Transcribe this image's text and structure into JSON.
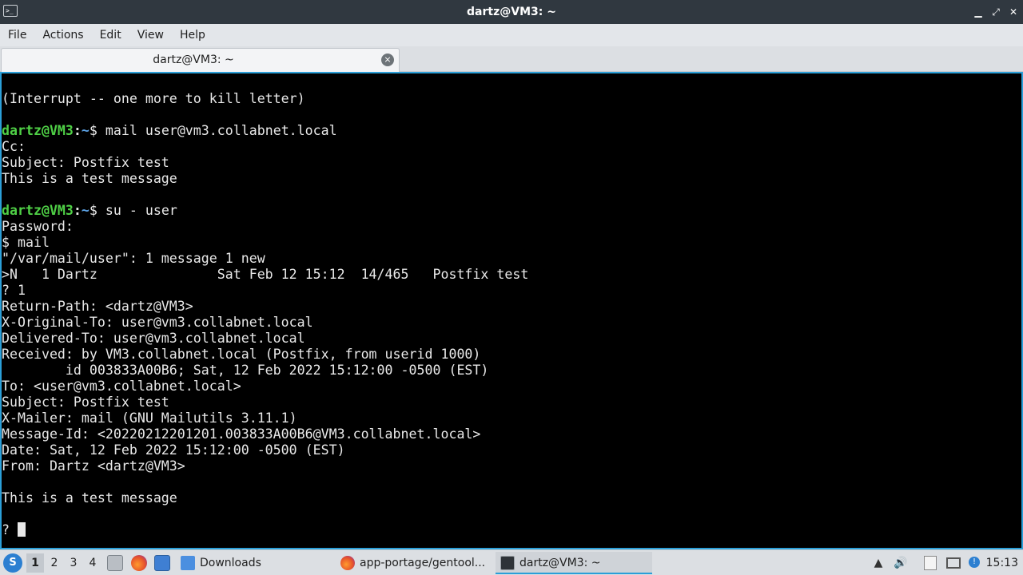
{
  "window": {
    "title": "dartz@VM3: ~",
    "app_icon": "terminal-icon",
    "controls": {
      "minimize": "▁",
      "maximize": "⤢",
      "close": "✕"
    }
  },
  "menu": [
    "File",
    "Actions",
    "Edit",
    "View",
    "Help"
  ],
  "tab": {
    "label": "dartz@VM3: ~",
    "close_icon": "⨯"
  },
  "terminal": {
    "colors": {
      "user": "#4fd046",
      "path": "#5da4e8",
      "text": "#e8e8e8",
      "border": "#2b9fd8"
    },
    "lines": [
      {
        "text": "(Interrupt -- one more to kill letter)"
      },
      {
        "text": ""
      },
      {
        "prompt": {
          "user": "dartz@VM3",
          "sep": ":",
          "path": "~",
          "sym": "$ "
        },
        "text": "mail user@vm3.collabnet.local"
      },
      {
        "text": "Cc:"
      },
      {
        "text": "Subject: Postfix test"
      },
      {
        "text": "This is a test message"
      },
      {
        "text": ""
      },
      {
        "prompt": {
          "user": "dartz@VM3",
          "sep": ":",
          "path": "~",
          "sym": "$ "
        },
        "text": "su - user"
      },
      {
        "text": "Password:"
      },
      {
        "text": "$ mail"
      },
      {
        "text": "\"/var/mail/user\": 1 message 1 new"
      },
      {
        "text": ">N   1 Dartz               Sat Feb 12 15:12  14/465   Postfix test"
      },
      {
        "text": "? 1"
      },
      {
        "text": "Return-Path: <dartz@VM3>"
      },
      {
        "text": "X-Original-To: user@vm3.collabnet.local"
      },
      {
        "text": "Delivered-To: user@vm3.collabnet.local"
      },
      {
        "text": "Received: by VM3.collabnet.local (Postfix, from userid 1000)"
      },
      {
        "text": "        id 003833A00B6; Sat, 12 Feb 2022 15:12:00 -0500 (EST)"
      },
      {
        "text": "To: <user@vm3.collabnet.local>"
      },
      {
        "text": "Subject: Postfix test"
      },
      {
        "text": "X-Mailer: mail (GNU Mailutils 3.11.1)"
      },
      {
        "text": "Message-Id: <20220212201201.003833A00B6@VM3.collabnet.local>"
      },
      {
        "text": "Date: Sat, 12 Feb 2022 15:12:00 -0500 (EST)"
      },
      {
        "text": "From: Dartz <dartz@VM3>"
      },
      {
        "text": ""
      },
      {
        "text": "This is a test message"
      },
      {
        "text": ""
      },
      {
        "text": "? ",
        "cursor": true
      }
    ]
  },
  "taskbar": {
    "start_icon": "start-menu-icon",
    "workspaces": [
      "1",
      "2",
      "3",
      "4"
    ],
    "active_workspace": "1",
    "quick_launch": [
      "file-manager-icon",
      "firefox-icon",
      "show-desktop-icon"
    ],
    "tasks": [
      {
        "label": "Downloads",
        "icon": "folder-icon"
      },
      {
        "label": "app-portage/gentool...",
        "icon": "firefox-icon"
      },
      {
        "label": "dartz@VM3: ~",
        "icon": "terminal-icon",
        "active": true
      }
    ],
    "tray": [
      "tray-arrow-icon",
      "volume-icon",
      "clipboard-icon",
      "display-icon",
      "update-icon"
    ],
    "clock": "15:13"
  }
}
